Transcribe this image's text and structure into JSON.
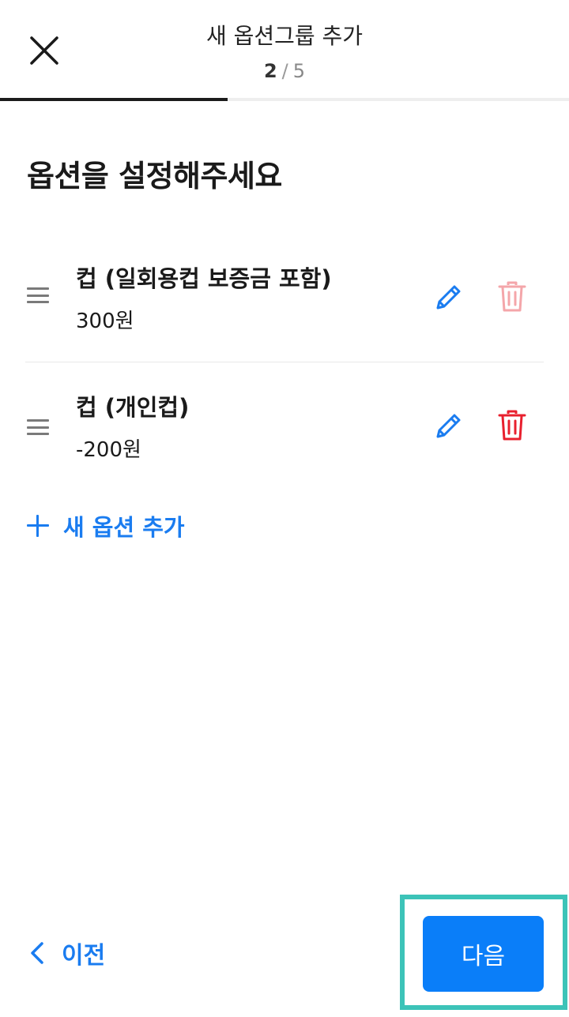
{
  "header": {
    "title": "새 옵션그룹 추가",
    "step_current": "2",
    "step_separator": "/",
    "step_total": "5",
    "progress_fraction": 0.4
  },
  "section_title": "옵션을 설정해주세요",
  "options": [
    {
      "name": "컵 (일회용컵 보증금 포함)",
      "price": "300원",
      "delete_enabled": false
    },
    {
      "name": "컵 (개인컵)",
      "price": "-200원",
      "delete_enabled": true
    }
  ],
  "add_option_label": "새 옵션 추가",
  "footer": {
    "prev_label": "이전",
    "next_label": "다음"
  },
  "colors": {
    "accent": "#1a7cf0",
    "primary_button": "#0a7ef9",
    "delete_active": "#e8202e",
    "delete_disabled": "#f4a6aa",
    "highlight": "#3cc3b8"
  },
  "icons": {
    "close": "close-icon",
    "drag": "drag-handle-icon",
    "edit": "pencil-icon",
    "delete": "trash-icon",
    "add": "plus-icon",
    "back": "chevron-left-icon"
  }
}
